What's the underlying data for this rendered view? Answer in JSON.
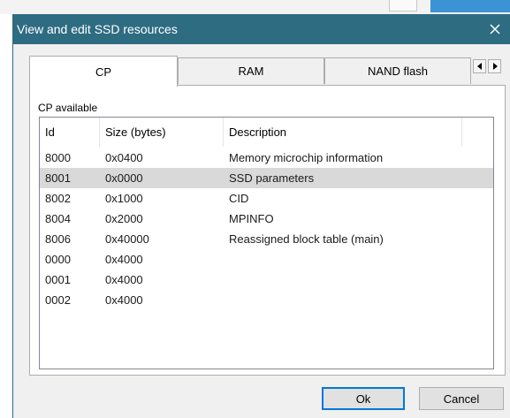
{
  "window": {
    "title": "View and edit SSD resources"
  },
  "tabs": [
    {
      "label": "CP",
      "active": true
    },
    {
      "label": "RAM",
      "active": false
    },
    {
      "label": "NAND flash",
      "active": false
    }
  ],
  "group_label": "CP available",
  "columns": [
    "Id",
    "Size (bytes)",
    "Description"
  ],
  "rows": [
    {
      "id": "8000",
      "size": "0x0400",
      "description": "Memory microchip information",
      "selected": false
    },
    {
      "id": "8001",
      "size": "0x0000",
      "description": "SSD parameters",
      "selected": true
    },
    {
      "id": "8002",
      "size": "0x1000",
      "description": "CID",
      "selected": false
    },
    {
      "id": "8004",
      "size": "0x2000",
      "description": "MPINFO",
      "selected": false
    },
    {
      "id": "8006",
      "size": "0x40000",
      "description": "Reassigned block table (main)",
      "selected": false
    },
    {
      "id": "0000",
      "size": "0x4000",
      "description": "",
      "selected": false
    },
    {
      "id": "0001",
      "size": "0x4000",
      "description": "",
      "selected": false
    },
    {
      "id": "0002",
      "size": "0x4000",
      "description": "",
      "selected": false
    }
  ],
  "buttons": {
    "ok": "Ok",
    "cancel": "Cancel"
  },
  "colors": {
    "titlebar": "#2e6c82",
    "selection": "#d9d9d9",
    "default_button_border": "#0078d7"
  },
  "icons": {
    "close": "close-icon",
    "tab_left": "arrow-left-icon",
    "tab_right": "arrow-right-icon"
  }
}
